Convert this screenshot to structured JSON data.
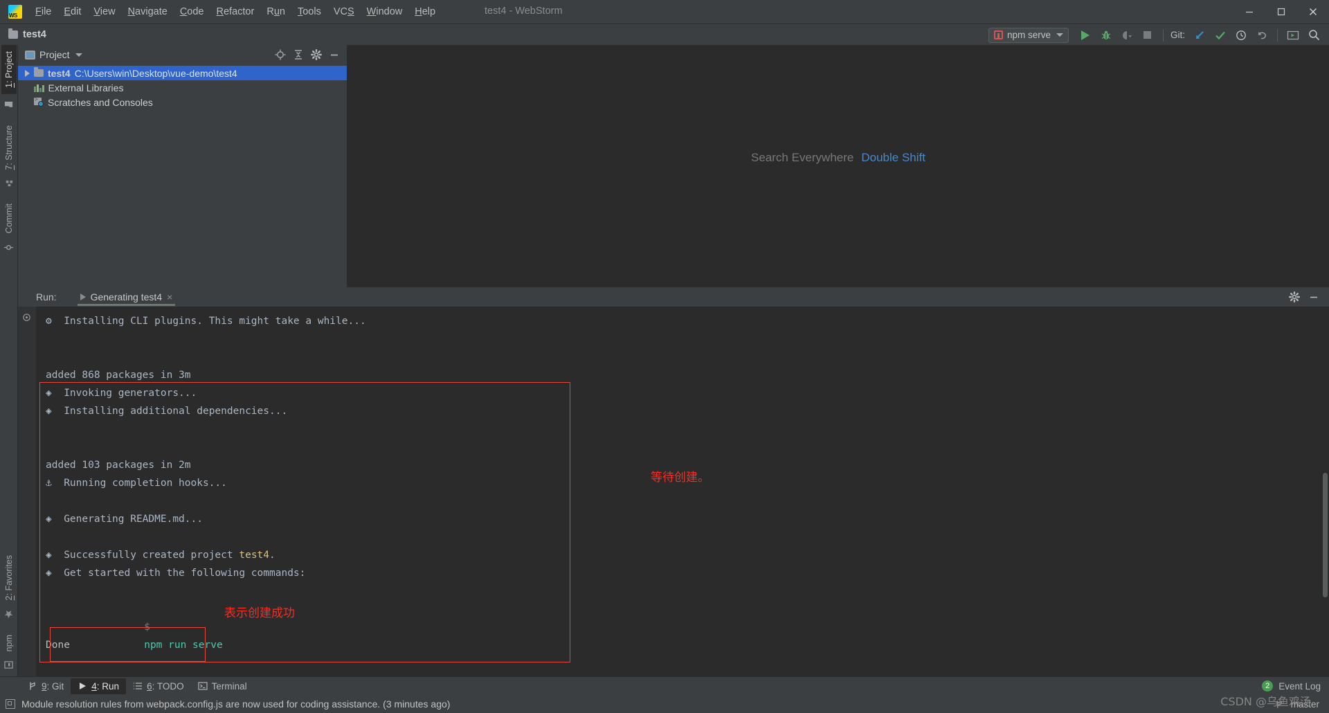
{
  "window": {
    "title": "test4 - WebStorm",
    "minimize_label": "—",
    "maximize_label": "❐",
    "close_label": "✕"
  },
  "menubar": {
    "logo": "webstorm-logo",
    "items": [
      {
        "label": "File",
        "mnemonic": "F"
      },
      {
        "label": "Edit",
        "mnemonic": "E"
      },
      {
        "label": "View",
        "mnemonic": "V"
      },
      {
        "label": "Navigate",
        "mnemonic": "N"
      },
      {
        "label": "Code",
        "mnemonic": "C"
      },
      {
        "label": "Refactor",
        "mnemonic": "R"
      },
      {
        "label": "Run",
        "mnemonic": "u"
      },
      {
        "label": "Tools",
        "mnemonic": "T"
      },
      {
        "label": "VCS",
        "mnemonic": "S"
      },
      {
        "label": "Window",
        "mnemonic": "W"
      },
      {
        "label": "Help",
        "mnemonic": "H"
      }
    ]
  },
  "navbar": {
    "breadcrumb": "test4",
    "run_config": {
      "label": "npm serve",
      "icon": "npm-icon",
      "dropdown": "chevron-down-icon"
    },
    "git_label": "Git:",
    "actions": [
      {
        "name": "run-button",
        "icon": "play-icon"
      },
      {
        "name": "debug-button",
        "icon": "bug-icon"
      },
      {
        "name": "run-with-coverage-button",
        "icon": "coverage-icon"
      },
      {
        "name": "stop-button",
        "icon": "stop-icon"
      },
      {
        "name": "git-update-button",
        "icon": "arrow-down-left-icon"
      },
      {
        "name": "git-commit-button",
        "icon": "check-icon"
      },
      {
        "name": "git-history-button",
        "icon": "clock-icon"
      },
      {
        "name": "git-rollback-button",
        "icon": "undo-icon"
      },
      {
        "name": "terminal-button",
        "icon": "terminal-window-icon"
      },
      {
        "name": "search-everywhere-button",
        "icon": "search-icon"
      }
    ]
  },
  "left_rail": {
    "top": [
      {
        "label": "1: Project",
        "mnemonic": "1",
        "icon": "project-folder-icon",
        "active": true
      },
      {
        "label": "7: Structure",
        "mnemonic": "7",
        "icon": "structure-icon",
        "active": false
      },
      {
        "label": "Commit",
        "mnemonic": "",
        "icon": "commit-icon",
        "active": false
      }
    ],
    "bottom": [
      {
        "label": "2: Favorites",
        "mnemonic": "2",
        "icon": "star-icon",
        "active": false
      },
      {
        "label": "npm",
        "mnemonic": "",
        "icon": "npm-panel-icon",
        "active": false
      }
    ]
  },
  "project_panel": {
    "title": "Project",
    "dropdown": "chevron-down-icon",
    "actions": [
      {
        "name": "select-opened-file-button",
        "icon": "target-icon"
      },
      {
        "name": "collapse-all-button",
        "icon": "collapse-all-icon"
      },
      {
        "name": "settings-button",
        "icon": "gear-icon"
      },
      {
        "name": "hide-button",
        "icon": "minimize-icon"
      }
    ],
    "tree": [
      {
        "name": "test4",
        "path": "C:\\Users\\win\\Desktop\\vue-demo\\test4",
        "icon": "folder-icon",
        "expandable": true,
        "selected": true
      },
      {
        "name": "External Libraries",
        "path": "",
        "icon": "libraries-icon",
        "expandable": false,
        "selected": false
      },
      {
        "name": "Scratches and Consoles",
        "path": "",
        "icon": "scratches-icon",
        "expandable": false,
        "selected": false
      }
    ]
  },
  "editor": {
    "hint_text": "Search Everywhere",
    "hint_key": "Double Shift"
  },
  "run_window": {
    "label": "Run:",
    "tab": {
      "title": "Generating test4",
      "close": "×",
      "icon": "play-icon"
    },
    "header_actions": [
      {
        "name": "settings-button",
        "icon": "gear-icon"
      },
      {
        "name": "hide-button",
        "icon": "minimize-icon"
      }
    ],
    "console": {
      "gutter_icon": "rerun-icon",
      "lines": [
        {
          "text": "⚙  Installing CLI plugins. This might take a while...",
          "style": "plain"
        },
        {
          "text": "",
          "style": "blank"
        },
        {
          "text": "",
          "style": "blank"
        },
        {
          "text": "added 868 packages in 3m",
          "style": "plain"
        },
        {
          "text": "◈  Invoking generators...",
          "style": "plain"
        },
        {
          "text": "◈  Installing additional dependencies...",
          "style": "plain"
        },
        {
          "text": "",
          "style": "blank"
        },
        {
          "text": "",
          "style": "blank"
        },
        {
          "text": "added 103 packages in 2m",
          "style": "plain"
        },
        {
          "text": "⚓  Running completion hooks...",
          "style": "plain"
        },
        {
          "text": "",
          "style": "blank"
        },
        {
          "text": "◈  Generating README.md...",
          "style": "plain"
        },
        {
          "text": "",
          "style": "blank"
        },
        {
          "text": "◈  Successfully created project test4.",
          "style": "highlight-project"
        },
        {
          "text": "◈  Get started with the following commands:",
          "style": "plain"
        }
      ],
      "success_line_prefix": "◈  Successfully created project ",
      "success_line_project": "test4",
      "success_line_suffix": ".",
      "command_prompt": "$",
      "command_text": "npm run serve",
      "done_text": "Done"
    },
    "annotations": [
      {
        "text": "等待创建。",
        "name": "annotation-waiting"
      },
      {
        "text": "表示创建成功",
        "name": "annotation-success"
      }
    ],
    "highlight_color": "#e8453c"
  },
  "bottom_bar": {
    "buttons": [
      {
        "label": "9: Git",
        "mnemonic": "9",
        "icon": "git-branch-icon",
        "active": false
      },
      {
        "label": "4: Run",
        "mnemonic": "4",
        "icon": "play-icon",
        "active": true
      },
      {
        "label": "6: TODO",
        "mnemonic": "6",
        "icon": "todo-list-icon",
        "active": false
      },
      {
        "label": "Terminal",
        "mnemonic": "",
        "icon": "terminal-icon",
        "active": false
      }
    ],
    "event_log": {
      "label": "Event Log",
      "badge": "2",
      "badge_color": "#499c54"
    }
  },
  "status_bar": {
    "message": "Module resolution rules from webpack.config.js are now used for coding assistance. (3 minutes ago)",
    "icon": "notification-icon",
    "branch": "master",
    "branch_icon": "git-branch-icon"
  },
  "watermark": "CSDN @乌鱼鸡汤"
}
